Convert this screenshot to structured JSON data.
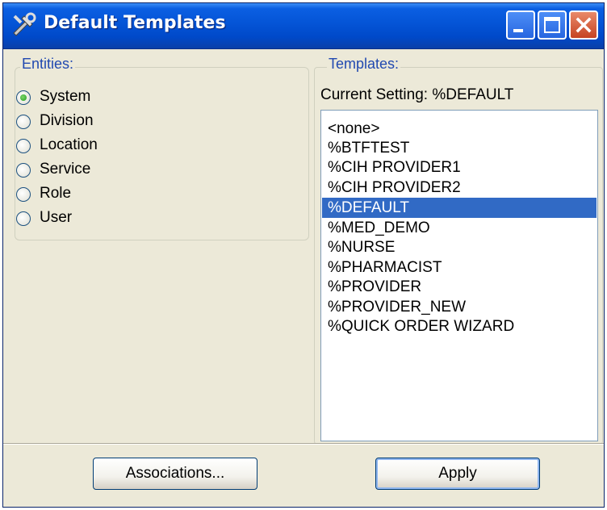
{
  "window": {
    "title": "Default Templates",
    "title_icon": "tools-icon",
    "controls": [
      "minimize-icon",
      "maximize-icon",
      "close-icon"
    ]
  },
  "entities": {
    "label": "Entities:",
    "options": [
      {
        "label": "System",
        "selected": true
      },
      {
        "label": "Division",
        "selected": false
      },
      {
        "label": "Location",
        "selected": false
      },
      {
        "label": "Service",
        "selected": false
      },
      {
        "label": "Role",
        "selected": false
      },
      {
        "label": "User",
        "selected": false
      }
    ]
  },
  "templates": {
    "label": "Templates:",
    "current_setting": "Current Setting:  %DEFAULT",
    "items": [
      "<none>",
      "%BTFTEST",
      "%CIH PROVIDER1",
      "%CIH PROVIDER2",
      "%DEFAULT",
      "%MED_DEMO",
      "%NURSE",
      "%PHARMACIST",
      "%PROVIDER",
      "%PROVIDER_NEW",
      "%QUICK ORDER WIZARD"
    ],
    "selected_index": 4
  },
  "buttons": {
    "associations": "Associations...",
    "apply": "Apply"
  },
  "colors": {
    "titlebar": "#0454d6",
    "selection": "#316ac5",
    "groupbox_label": "#2149b0",
    "window_bg": "#ece9d8"
  }
}
